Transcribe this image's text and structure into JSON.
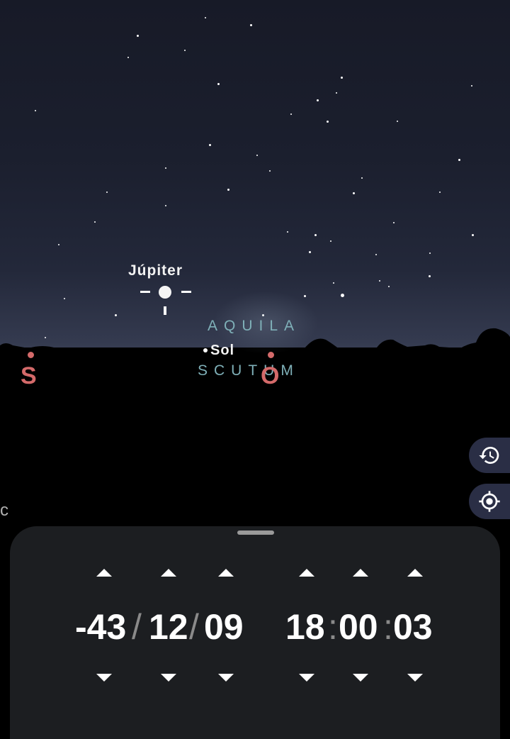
{
  "sky": {
    "planet_label": "Júpiter",
    "sun_label": "Sol",
    "constellations": [
      "AQUILA",
      "SCUTUM"
    ],
    "cardinals": {
      "south": "S",
      "west": "O"
    },
    "edge_letter": "c"
  },
  "side_buttons": [
    {
      "icon": "history-icon"
    },
    {
      "icon": "locate-icon"
    }
  ],
  "time_panel": {
    "year": "-43",
    "month": "12",
    "day": "09",
    "hour": "18",
    "minute": "00",
    "second": "03",
    "date_separator": "/",
    "time_separator": ":"
  },
  "colors": {
    "cardinal": "#d46a6a",
    "constellation": "#7fb0b8",
    "panel_bg": "#1c1e21",
    "button_bg": "#2a2e45"
  }
}
